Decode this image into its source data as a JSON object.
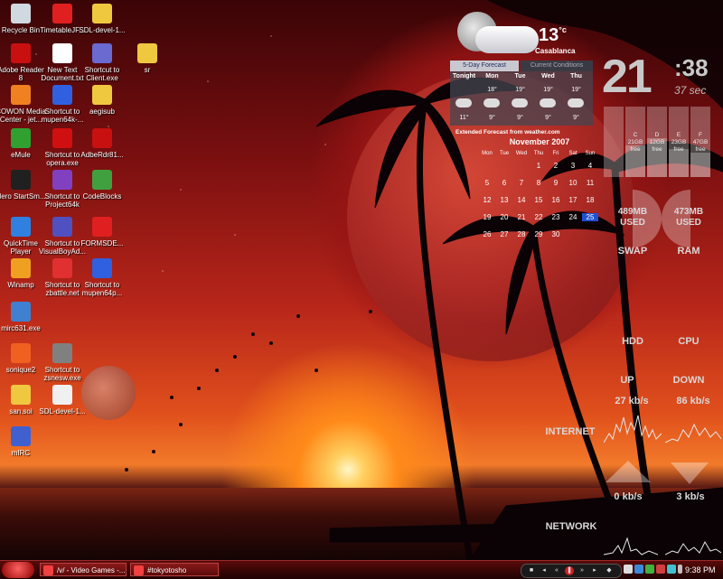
{
  "desktop_icons": [
    {
      "label": "Recycle Bin",
      "icon": "recycle-bin-icon",
      "color": "#d0d8e0"
    },
    {
      "label": "TimetableJF...",
      "icon": "pdf-icon",
      "color": "#e02020"
    },
    {
      "label": "SDL-devel-1...",
      "icon": "folder-icon",
      "color": "#f0c840"
    },
    {
      "label": "Adobe Reader 8",
      "icon": "adobe-reader-icon",
      "color": "#c81010"
    },
    {
      "label": "New Text Document.txt",
      "icon": "text-file-icon",
      "color": "#ffffff"
    },
    {
      "label": "Shortcut to Client.exe",
      "icon": "client-exe-icon",
      "color": "#6a6ad0"
    },
    {
      "label": "sr",
      "icon": "folder-icon",
      "color": "#f0c840"
    },
    {
      "label": "COWON Media Center - jet...",
      "icon": "cowon-icon",
      "color": "#f08020"
    },
    {
      "label": "Shortcut to mupen64k-...",
      "icon": "mupen-icon",
      "color": "#3060e0"
    },
    {
      "label": "aegisub",
      "icon": "folder-icon",
      "color": "#f0c840"
    },
    {
      "label": "eMule",
      "icon": "emule-icon",
      "color": "#30a030"
    },
    {
      "label": "Shortcut to opera.exe",
      "icon": "opera-icon",
      "color": "#d01010"
    },
    {
      "label": "AdbeRdr81...",
      "icon": "adobe-installer-icon",
      "color": "#c81010"
    },
    {
      "label": "Nero StartSm...",
      "icon": "nero-icon",
      "color": "#202020"
    },
    {
      "label": "Shortcut to Project64k",
      "icon": "project64-icon",
      "color": "#8040c0"
    },
    {
      "label": "CodeBlocks",
      "icon": "codeblocks-icon",
      "color": "#40a040"
    },
    {
      "label": "QuickTime Player",
      "icon": "quicktime-icon",
      "color": "#3080e0"
    },
    {
      "label": "Shortcut to VisualBoyAd...",
      "icon": "visualboy-icon",
      "color": "#5050c0"
    },
    {
      "label": "FORMSDE...",
      "icon": "pdf-icon",
      "color": "#e02020"
    },
    {
      "label": "Winamp",
      "icon": "winamp-icon",
      "color": "#f0a020"
    },
    {
      "label": "Shortcut to zbattle.net",
      "icon": "zbattle-icon",
      "color": "#e03030"
    },
    {
      "label": "Shortcut to mupen64p...",
      "icon": "mupen-icon",
      "color": "#3060e0"
    },
    {
      "label": "mirc631.exe",
      "icon": "mirc-installer-icon",
      "color": "#4080d0"
    },
    {
      "label": "sonique2",
      "icon": "sonique-icon",
      "color": "#f06020"
    },
    {
      "label": "Shortcut to zsnesw.exe",
      "icon": "zsnes-icon",
      "color": "#808080"
    },
    {
      "label": "san.soi",
      "icon": "folder-icon",
      "color": "#f0c840"
    },
    {
      "label": "SDL-devel-1...",
      "icon": "archive-icon",
      "color": "#f0f0f0"
    },
    {
      "label": "mIRC",
      "icon": "mirc-icon",
      "color": "#4060d0"
    }
  ],
  "weather": {
    "temp": "13",
    "unit": "°c",
    "city": "Casablanca",
    "tabs": [
      "5-Day Forecast",
      "Current Conditions"
    ],
    "days": [
      "Tonight",
      "Mon",
      "Tue",
      "Wed",
      "Thu"
    ],
    "highs": [
      "",
      "18°",
      "19°",
      "19°",
      "19°"
    ],
    "lows": [
      "11°",
      "9°",
      "9°",
      "9°",
      "9°"
    ],
    "footer": "Extended Forecast from weather.com"
  },
  "calendar": {
    "title": "November 2007",
    "weekdays": [
      "Mon",
      "Tue",
      "Wed",
      "Thu",
      "Fri",
      "Sat",
      "Sun"
    ],
    "first_weekday_index": 3,
    "days_in_month": 30,
    "today": 25,
    "today_color": "#2050d0"
  },
  "clock": {
    "hours": "21",
    "minutes": ":38",
    "seconds": "37 sec"
  },
  "drives": [
    {
      "letter": "C",
      "free": "21GB",
      "label": "free",
      "free_fraction": 0.45
    },
    {
      "letter": "D",
      "free": "12GB",
      "label": "free",
      "free_fraction": 0.55
    },
    {
      "letter": "E",
      "free": "23GB",
      "label": "free",
      "free_fraction": 0.4
    },
    {
      "letter": "F",
      "free": "47GB",
      "label": "free",
      "free_fraction": 0.35
    }
  ],
  "memory": {
    "swap": {
      "value": "489MB",
      "used": "USED",
      "label": "SWAP"
    },
    "ram": {
      "value": "473MB",
      "used": "USED",
      "label": "RAM"
    }
  },
  "meters": {
    "hdd": "HDD",
    "cpu": "CPU"
  },
  "internet": {
    "up_label": "UP",
    "down_label": "DOWN",
    "up_rate": "27 kb/s",
    "down_rate": "86 kb/s",
    "title": "INTERNET"
  },
  "network": {
    "up_rate": "0 kb/s",
    "down_rate": "3 kb/s",
    "title": "NETWORK"
  },
  "taskbar": {
    "tasks": [
      "/v/ - Video Games -...",
      "#tokyotosho"
    ],
    "time": "9:38 PM"
  }
}
